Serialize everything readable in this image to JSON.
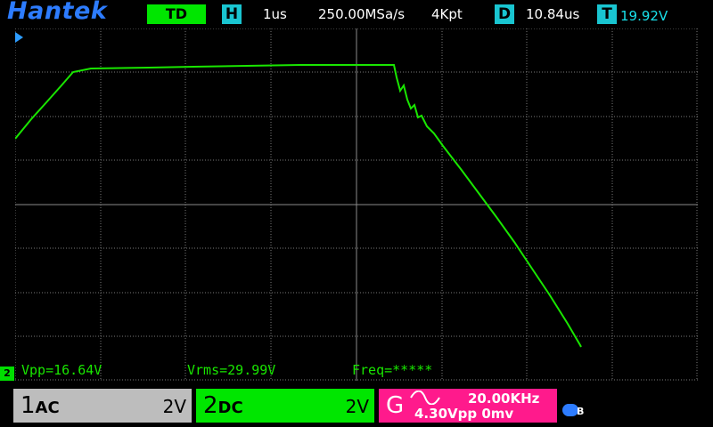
{
  "brand": "Hantek",
  "header": {
    "mode": "TD",
    "h_tag": "H",
    "timebase": "1us",
    "sample_rate": "250.00MSa/s",
    "memory_depth": "4Kpt",
    "d_tag": "D",
    "delay": "10.84us",
    "t_tag": "T",
    "trigger_level": "19.92V"
  },
  "measurements": {
    "vpp": "Vpp=16.64V",
    "vrms": "Vrms=29.99V",
    "freq": "Freq=*****"
  },
  "channels": {
    "ch1": {
      "num": "1",
      "coupling": "AC",
      "scale": "2V"
    },
    "ch2": {
      "num": "2",
      "coupling": "DC",
      "scale": "2V"
    }
  },
  "generator": {
    "letter": "G",
    "frequency": "20.00KHz",
    "amplitude": "4.30Vpp",
    "offset": "0mv"
  },
  "channel_marker": "2",
  "colors": {
    "trace": "#19e600",
    "brand": "#2d7cff",
    "tag": "#19c5d1",
    "generator": "#ff1a8c"
  },
  "icons": [
    "sine-wave-icon",
    "status-indicator-icon",
    "trigger-position-icon"
  ]
}
